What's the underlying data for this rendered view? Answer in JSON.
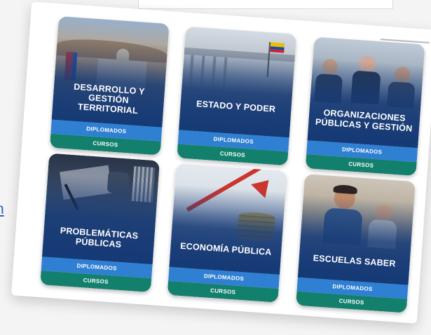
{
  "side_link": {
    "label": "n"
  },
  "cards": [
    {
      "title": "DESARROLLO Y GESTIÓN TERRITORIAL",
      "diplomados": "DIPLOMADOS",
      "cursos": "CURSOS"
    },
    {
      "title": "ESTADO Y PODER",
      "diplomados": "DIPLOMADOS",
      "cursos": "CURSOS"
    },
    {
      "title": "ORGANIZACIONES PÚBLICAS Y GESTIÓN",
      "diplomados": "DIPLOMADOS",
      "cursos": "CURSOS"
    },
    {
      "title": "PROBLEMÁTICAS PÚBLICAS",
      "diplomados": "DIPLOMADOS",
      "cursos": "CURSOS"
    },
    {
      "title": "ECONOMÍA PÚBLICA",
      "diplomados": "DIPLOMADOS",
      "cursos": "CURSOS"
    },
    {
      "title": "ESCUELAS SABER",
      "diplomados": "DIPLOMADOS",
      "cursos": "CURSOS"
    }
  ],
  "colors": {
    "card_blue": "#163a76",
    "diplomados_bg": "#2f7fd2",
    "cursos_bg": "#13806e",
    "link": "#2f63b8"
  }
}
